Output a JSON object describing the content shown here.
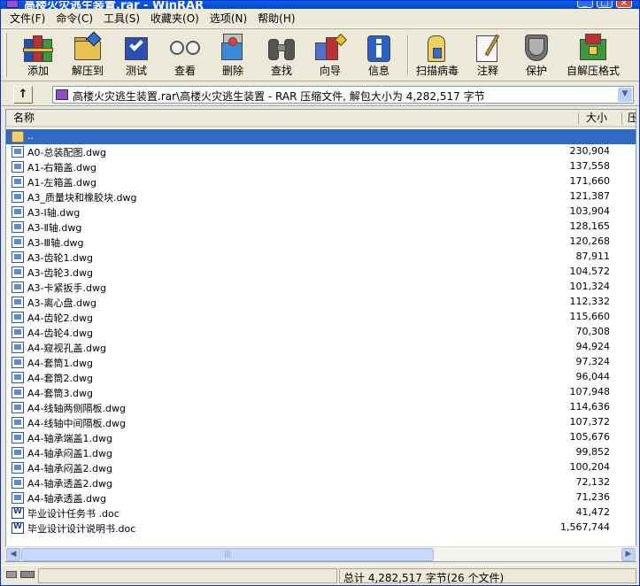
{
  "window": {
    "title": "高楼火灾逃生装置.rar - WinRAR"
  },
  "menu": [
    "文件(F)",
    "命令(C)",
    "工具(S)",
    "收藏夹(O)",
    "选项(N)",
    "帮助(H)"
  ],
  "toolbar": {
    "buttons": [
      {
        "label": "添加",
        "icon": "add-archive-icon"
      },
      {
        "label": "解压到",
        "icon": "extract-to-icon"
      },
      {
        "label": "测试",
        "icon": "test-icon"
      },
      {
        "label": "查看",
        "icon": "view-icon"
      },
      {
        "label": "删除",
        "icon": "delete-icon"
      },
      {
        "label": "查找",
        "icon": "find-icon"
      },
      {
        "label": "向导",
        "icon": "wizard-icon"
      },
      {
        "label": "信息",
        "icon": "info-icon"
      },
      {
        "label": "扫描病毒",
        "icon": "virus-scan-icon"
      },
      {
        "label": "注释",
        "icon": "comment-icon"
      },
      {
        "label": "保护",
        "icon": "protect-icon"
      },
      {
        "label": "自解压格式",
        "icon": "sfx-icon"
      }
    ]
  },
  "address": {
    "up_label": "↑",
    "path": "高楼火灾逃生装置.rar\\高楼火灾逃生装置 - RAR 压缩文件, 解包大小为 4,282,517 字节"
  },
  "list": {
    "columns": {
      "name": "名称",
      "size": "大小",
      "ratio": "压"
    },
    "updir": "..",
    "files": [
      {
        "name": "A0-总装配图.dwg",
        "size": "230,904",
        "type": "dwg"
      },
      {
        "name": "A1-右箱盖.dwg",
        "size": "137,558",
        "type": "dwg"
      },
      {
        "name": "A1-左箱盖.dwg",
        "size": "171,660",
        "type": "dwg"
      },
      {
        "name": "A3_质量块和橡胶块.dwg",
        "size": "121,387",
        "type": "dwg"
      },
      {
        "name": "A3-Ⅰ轴.dwg",
        "size": "103,904",
        "type": "dwg"
      },
      {
        "name": "A3-Ⅱ轴.dwg",
        "size": "128,165",
        "type": "dwg"
      },
      {
        "name": "A3-Ⅲ轴.dwg",
        "size": "120,268",
        "type": "dwg"
      },
      {
        "name": "A3-齿轮1.dwg",
        "size": "87,911",
        "type": "dwg"
      },
      {
        "name": "A3-齿轮3.dwg",
        "size": "104,572",
        "type": "dwg"
      },
      {
        "name": "A3-卡紧扳手.dwg",
        "size": "101,324",
        "type": "dwg"
      },
      {
        "name": "A3-离心盘.dwg",
        "size": "112,332",
        "type": "dwg"
      },
      {
        "name": "A4-齿轮2.dwg",
        "size": "115,660",
        "type": "dwg"
      },
      {
        "name": "A4-齿轮4.dwg",
        "size": "70,308",
        "type": "dwg"
      },
      {
        "name": "A4-窥视孔盖.dwg",
        "size": "94,924",
        "type": "dwg"
      },
      {
        "name": "A4-套筒1.dwg",
        "size": "97,324",
        "type": "dwg"
      },
      {
        "name": "A4-套筒2.dwg",
        "size": "96,044",
        "type": "dwg"
      },
      {
        "name": "A4-套筒3.dwg",
        "size": "107,948",
        "type": "dwg"
      },
      {
        "name": "A4-线轴两侧隔板.dwg",
        "size": "114,636",
        "type": "dwg"
      },
      {
        "name": "A4-线轴中间隔板.dwg",
        "size": "107,372",
        "type": "dwg"
      },
      {
        "name": "A4-轴承端盖1.dwg",
        "size": "105,676",
        "type": "dwg"
      },
      {
        "name": "A4-轴承闷盖1.dwg",
        "size": "99,852",
        "type": "dwg"
      },
      {
        "name": "A4-轴承闷盖2.dwg",
        "size": "100,204",
        "type": "dwg"
      },
      {
        "name": "A4-轴承透盖2.dwg",
        "size": "72,132",
        "type": "dwg"
      },
      {
        "name": "A4-轴承透盖.dwg",
        "size": "71,236",
        "type": "dwg"
      },
      {
        "name": "毕业设计任务书 .doc",
        "size": "41,472",
        "type": "doc"
      },
      {
        "name": "毕业设计设计说明书.doc",
        "size": "1,567,744",
        "type": "doc"
      }
    ]
  },
  "status": {
    "total": "总计 4,282,517 字节(26 个文件)"
  },
  "colors": {
    "selection": "#316AC5",
    "titlebar": "#0A5FE0",
    "face": "#ECE9D8"
  }
}
